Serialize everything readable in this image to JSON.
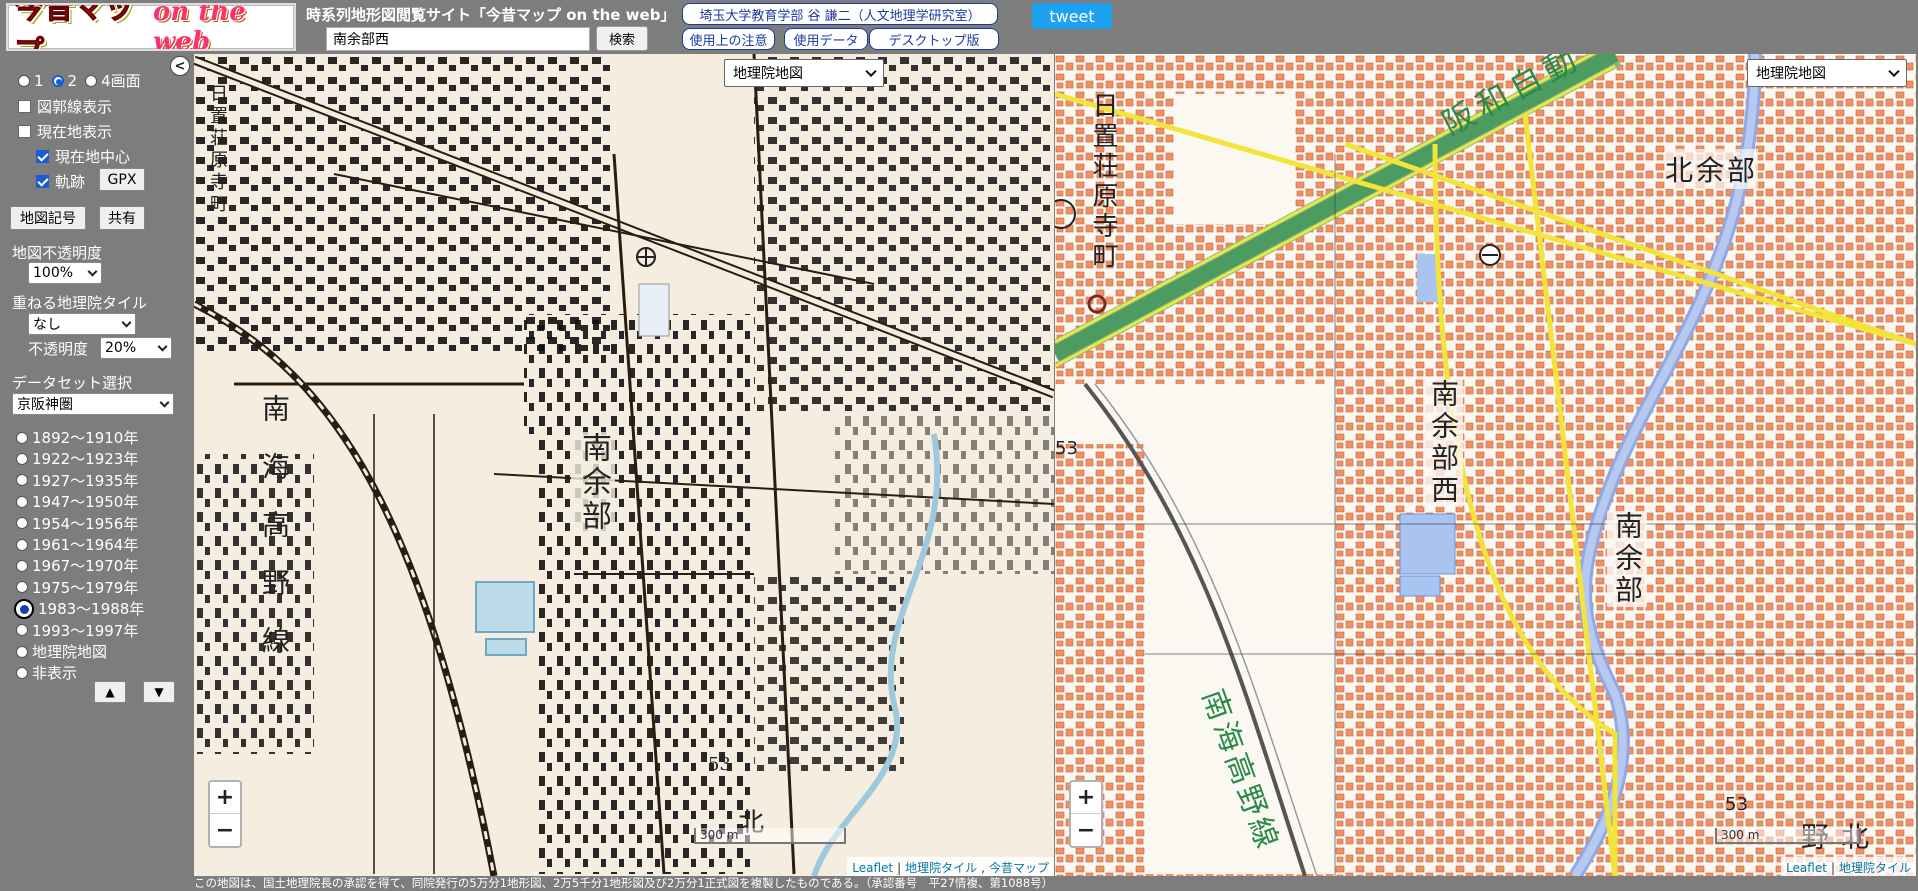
{
  "header": {
    "logo_main": "今昔マップ",
    "logo_sub": "on the web",
    "site_title": "時系列地形図閲覧サイト「今昔マップ on the web」",
    "search_value": "南余部西",
    "search_button": "検索",
    "links": [
      "埼玉大学教育学部 谷 謙二（人文地理学研究室）",
      "使用上の注意",
      "使用データ",
      "デスクトップ版"
    ],
    "tweet": "tweet"
  },
  "sidebar": {
    "collapse_icon": "chevron-left-icon",
    "screens": {
      "options": [
        "1",
        "2",
        "4画面"
      ],
      "selected": "2"
    },
    "show_grid": "図郭線表示",
    "show_location": "現在地表示",
    "center_location": "現在地中心",
    "track": "軌跡",
    "gpx": "GPX",
    "map_symbols": "地図記号",
    "share": "共有",
    "opacity_label": "地図不透明度",
    "opacity_value": "100%",
    "overlay_label": "重ねる地理院タイル",
    "overlay_value": "なし",
    "overlay_opacity_label": "不透明度",
    "overlay_opacity_value": "20%",
    "dataset_label": "データセット選択",
    "dataset_value": "京阪神圏",
    "periods": [
      "1892〜1910年",
      "1922〜1923年",
      "1927〜1935年",
      "1947〜1950年",
      "1954〜1956年",
      "1961〜1964年",
      "1967〜1970年",
      "1975〜1979年",
      "1983〜1988年",
      "1993〜1997年",
      "地理院地図",
      "非表示"
    ],
    "selected_period": "1983〜1988年",
    "up": "▲",
    "down": "▼"
  },
  "maps": {
    "left": {
      "layer": "地理院地図",
      "labels": {
        "town_v1": "日置荘原寺町",
        "area": "南余部",
        "rail": "南海高野線",
        "elev": "53",
        "north": "北"
      },
      "scale": "300 m",
      "attribution": [
        "Leaflet",
        "地理院タイル",
        "今昔マップ"
      ]
    },
    "right": {
      "layer": "地理院地図",
      "labels": {
        "highway": "阪和自動",
        "town1": "日置荘原寺町",
        "kita": "北余部",
        "nishi": "南余部西",
        "minami": "南余部",
        "rail": "南海高野線",
        "elev": "53",
        "kitano": "北野",
        "e53": "53"
      },
      "scale": "300 m",
      "attribution": [
        "Leaflet",
        "地理院タイル"
      ]
    },
    "zoom_in": "+",
    "zoom_out": "−"
  },
  "footer": "この地図は、国土地理院長の承認を得て、同院発行の5万分1地形図、2万5千分1地形図及び2万分1正式図を複製したものである。（承認番号　平27情複、第1088号）"
}
